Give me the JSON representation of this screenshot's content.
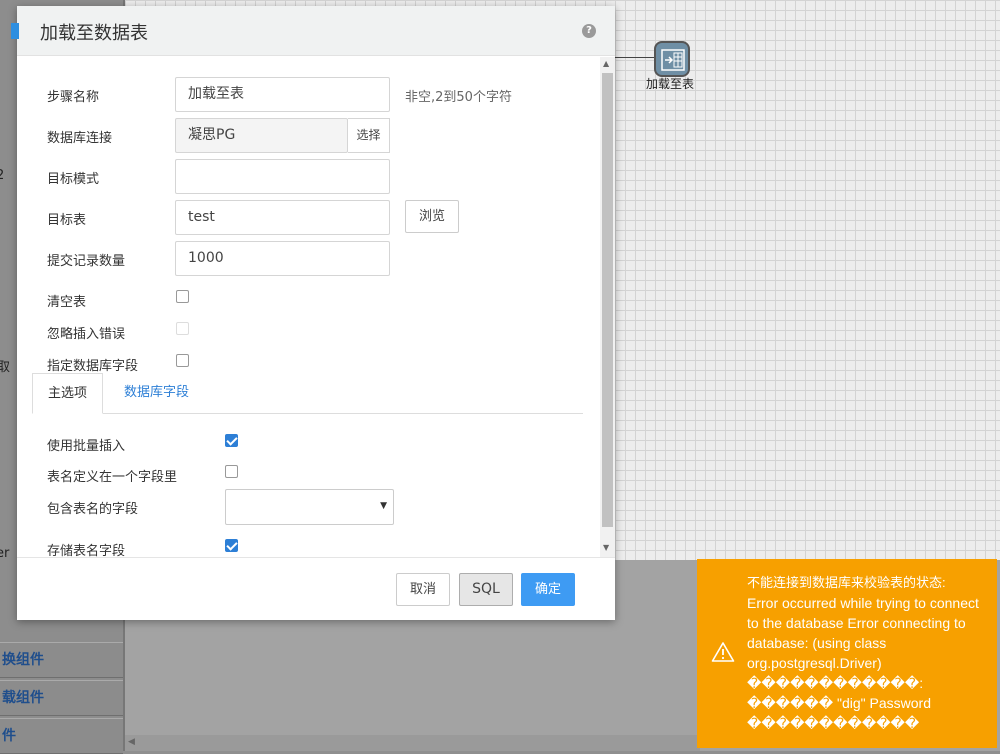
{
  "left_panel": {
    "fragments": [
      "2",
      "取",
      "er"
    ],
    "items": [
      "换组件",
      "载组件",
      "件"
    ]
  },
  "canvas": {
    "step_label": "加载至表"
  },
  "dialog": {
    "title": "加载至数据表",
    "help_icon": "?",
    "fields": {
      "step_name": {
        "label": "步骤名称",
        "value": "加载至表",
        "hint": "非空,2到50个字符"
      },
      "db_connection": {
        "label": "数据库连接",
        "value": "凝思PG",
        "button": "选择"
      },
      "target_schema": {
        "label": "目标模式",
        "value": ""
      },
      "target_table": {
        "label": "目标表",
        "value": "test",
        "button": "浏览"
      },
      "commit_size": {
        "label": "提交记录数量",
        "value": "1000"
      },
      "truncate_table": {
        "label": "清空表",
        "checked": false
      },
      "ignore_insert_errors": {
        "label": "忽略插入错误",
        "checked": false
      },
      "specify_db_fields": {
        "label": "指定数据库字段",
        "checked": false
      }
    },
    "tabs": [
      "主选项",
      "数据库字段"
    ],
    "main_options": {
      "use_batch_insert": {
        "label": "使用批量插入",
        "checked": true
      },
      "table_name_in_field": {
        "label": "表名定义在一个字段里",
        "checked": false
      },
      "table_name_field": {
        "label": "包含表名的字段",
        "value": ""
      },
      "store_table_name_field": {
        "label": "存储表名字段",
        "checked": true
      }
    },
    "footer": {
      "cancel": "取消",
      "sql": "SQL",
      "ok": "确定"
    }
  },
  "toast": {
    "title": "不能连接到数据库来校验表的状态:",
    "body": "Error occurred while trying to connect to the database  Error connecting to database: (using class org.postgresql.Driver) ������������: ������ \"dig\" Password ������������"
  }
}
